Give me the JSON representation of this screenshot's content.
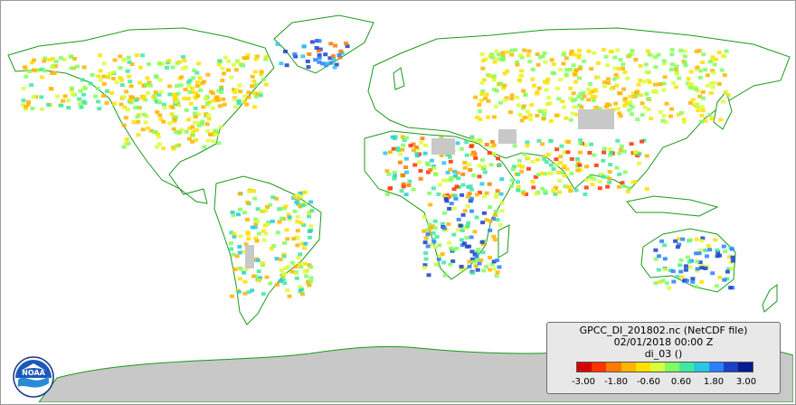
{
  "legend": {
    "title": "GPCC_DI_201802.nc (NetCDF file)",
    "date": "02/01/2018 00:00 Z",
    "variable": "di_03 ()",
    "ticks": [
      "-3.00",
      "-1.80",
      "-0.60",
      "0.60",
      "1.80",
      "3.00"
    ],
    "colors": [
      "#d70000",
      "#ff3300",
      "#ff7a00",
      "#ffb400",
      "#ffe000",
      "#d9ff3a",
      "#80ff60",
      "#40e8a0",
      "#28c8e0",
      "#2a80ff",
      "#1a40c8",
      "#0a1a90"
    ]
  },
  "map": {
    "land_color": "#ffffff",
    "border_color": "#1a9a1a",
    "nodata_color": "#c8c8c8"
  },
  "logo": {
    "text": "NOAA"
  }
}
